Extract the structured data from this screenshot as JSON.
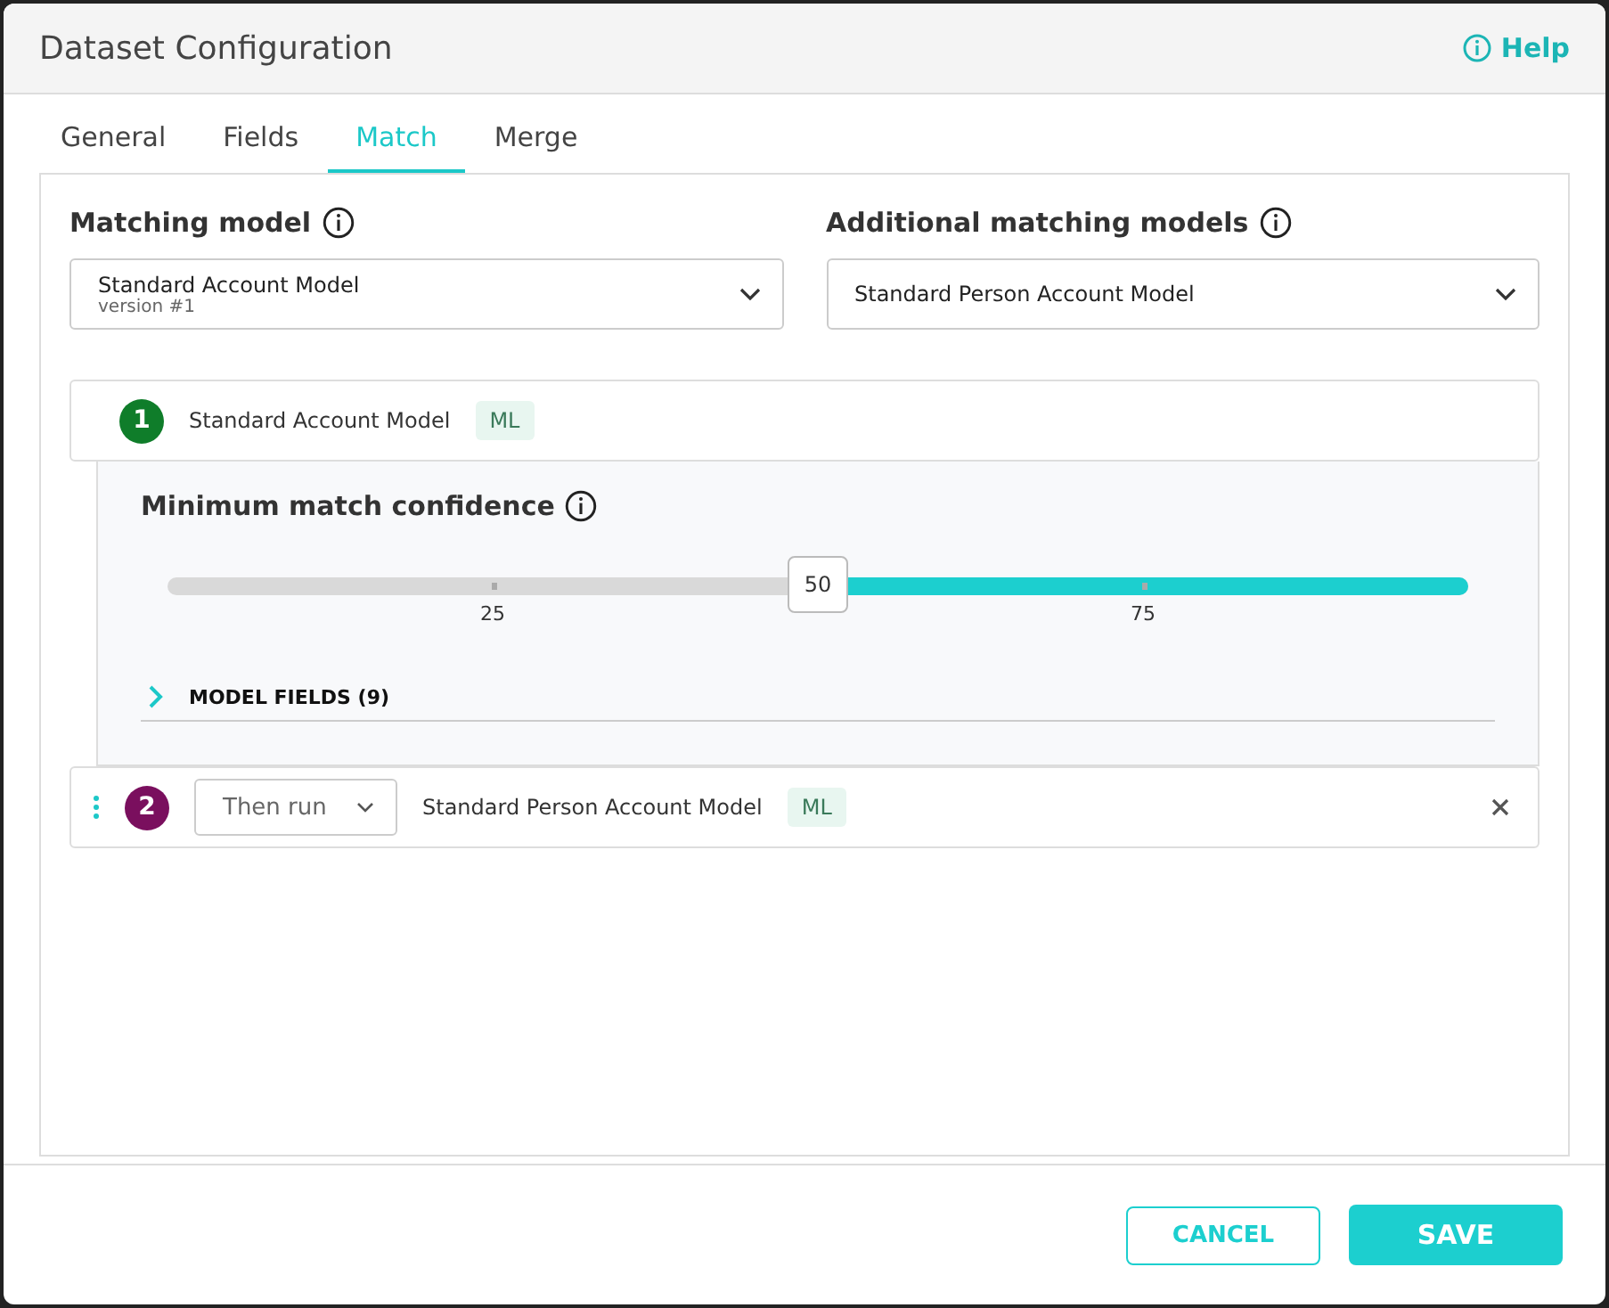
{
  "window": {
    "title": "Dataset Configuration",
    "help": "Help"
  },
  "tabs": [
    {
      "label": "General",
      "selected": false
    },
    {
      "label": "Fields",
      "selected": false
    },
    {
      "label": "Match",
      "selected": true
    },
    {
      "label": "Merge",
      "selected": false
    }
  ],
  "matching_model": {
    "label": "Matching model",
    "value": "Standard Account Model",
    "version": "version #1"
  },
  "additional_models": {
    "label": "Additional matching models",
    "value": "Standard Person Account Model"
  },
  "models": [
    {
      "number": "1",
      "name": "Standard Account Model",
      "tag": "ML",
      "color": "#0f7d2a",
      "expanded": true
    },
    {
      "number": "2",
      "name": "Standard Person Account Model",
      "tag": "ML",
      "color": "#7a0f5e",
      "expanded": false,
      "run_mode": "Then run"
    }
  ],
  "confidence": {
    "label": "Minimum match confidence",
    "level": 0.5,
    "value": "50",
    "ticks": [
      "25",
      "75"
    ]
  },
  "model_fields": {
    "label": "MODEL FIELDS (9)",
    "expanded": false
  },
  "buttons": {
    "cancel": "CANCEL",
    "save": "SAVE"
  }
}
